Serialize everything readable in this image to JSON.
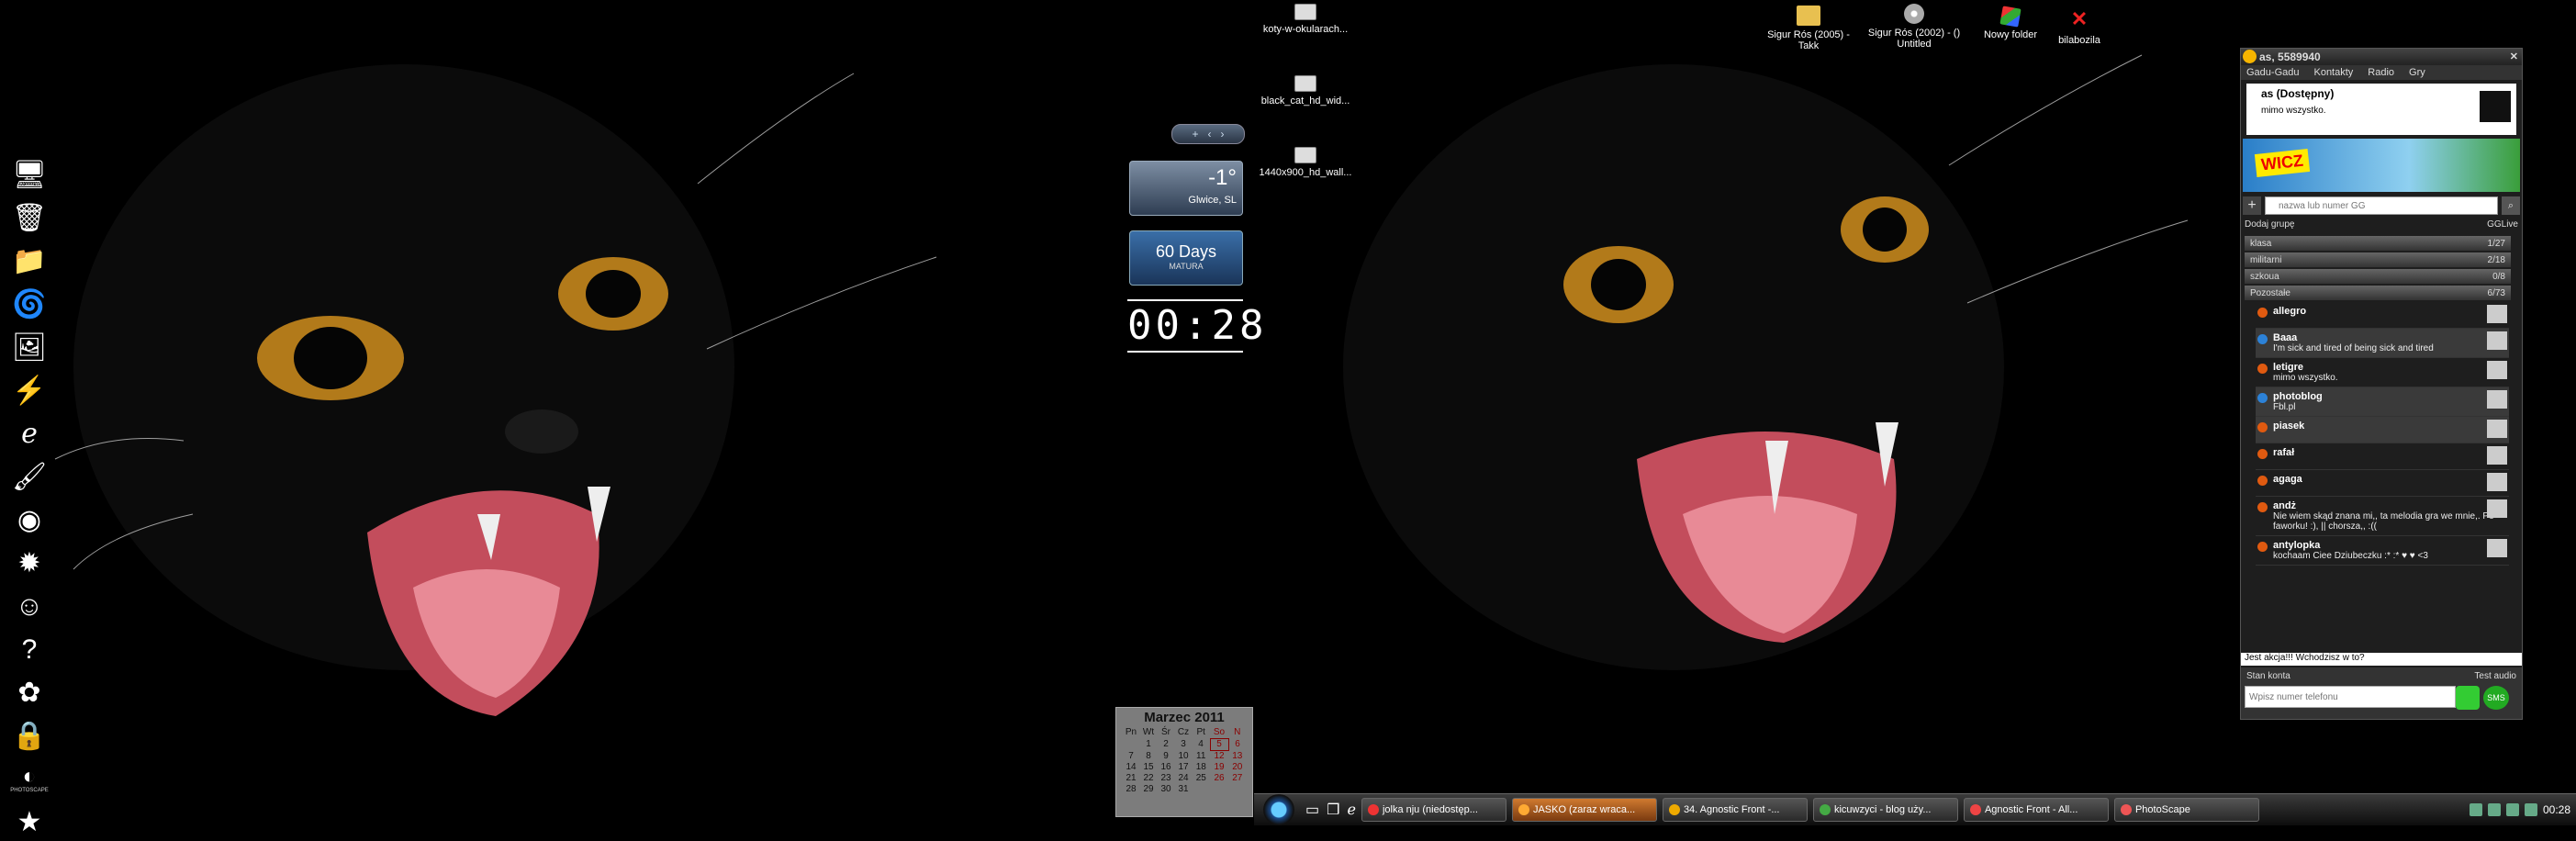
{
  "desktop": {
    "file_icons": [
      {
        "label": "koty-w-okularach..."
      },
      {
        "label": "black_cat_hd_wid..."
      },
      {
        "label": "1440x900_hd_wall..."
      }
    ],
    "top_icons": [
      {
        "label": "Sigur Rós (2005) - Takk",
        "icon": "folder-icon"
      },
      {
        "label": "Sigur Rós (2002) - () Untitled",
        "icon": "cd-icon"
      },
      {
        "label": "Nowy folder",
        "icon": "folder-icon"
      },
      {
        "label": "bilabozila",
        "icon": "x-icon"
      }
    ],
    "dock": [
      {
        "icon": "computer-icon",
        "glyph": "🖥"
      },
      {
        "icon": "recycle-bin-icon",
        "glyph": "🗑"
      },
      {
        "icon": "folder-icon",
        "glyph": "📁"
      },
      {
        "icon": "ccleaner-icon",
        "glyph": "🌀"
      },
      {
        "icon": "picture-icon",
        "glyph": "🖼"
      },
      {
        "icon": "winamp-icon",
        "glyph": "⚡"
      },
      {
        "icon": "internet-explorer-icon",
        "glyph": "ℯ"
      },
      {
        "icon": "paint-icon",
        "glyph": "🖌"
      },
      {
        "icon": "chrome-icon",
        "glyph": "◉"
      },
      {
        "icon": "gadu-gadu-icon",
        "glyph": "✹"
      },
      {
        "icon": "smiley-icon",
        "glyph": "☺"
      },
      {
        "icon": "help-icon",
        "glyph": "?"
      },
      {
        "icon": "picasa-icon",
        "glyph": "✿"
      },
      {
        "icon": "lock-icon",
        "glyph": "🔒"
      },
      {
        "icon": "photoscape-icon",
        "glyph": "◐",
        "label": "PHOTOSCAPE"
      },
      {
        "icon": "star-icon",
        "glyph": "★"
      }
    ]
  },
  "gadgets": {
    "toolbar": {
      "add": "+",
      "prev": "‹",
      "next": "›"
    },
    "weather": {
      "temp": "-1°",
      "city": "Glwice, SL"
    },
    "countdown": {
      "days": "60 Days",
      "label": "MATURA"
    },
    "clock": {
      "time": "00:28"
    },
    "calendar": {
      "title": "Marzec 2011",
      "weekdays": [
        "Pn",
        "Wt",
        "Śr",
        "Cz",
        "Pt",
        "So",
        "N"
      ],
      "weeks": [
        [
          "",
          "1",
          "2",
          "3",
          "4",
          "5",
          "6"
        ],
        [
          "7",
          "8",
          "9",
          "10",
          "11",
          "12",
          "13"
        ],
        [
          "14",
          "15",
          "16",
          "17",
          "18",
          "19",
          "20"
        ],
        [
          "21",
          "22",
          "23",
          "24",
          "25",
          "26",
          "27"
        ],
        [
          "28",
          "29",
          "30",
          "31",
          "",
          "",
          ""
        ]
      ],
      "today": "5"
    }
  },
  "gg": {
    "title": "as, 5589940",
    "menu": [
      "Gadu-Gadu",
      "Kontakty",
      "Radio",
      "Gry"
    ],
    "status_name": "as (Dostępny)",
    "status_desc": "mimo wszystko.",
    "ad_logo": "WICZ",
    "search_placeholder": "nazwa lub numer GG",
    "add_group": "Dodaj grupę",
    "gglive": "GGLive",
    "groups": [
      {
        "name": "klasa",
        "count": "1/27"
      },
      {
        "name": "militarni",
        "count": "2/18"
      },
      {
        "name": "szkoua",
        "count": "0/8"
      },
      {
        "name": "Pozostałe",
        "count": "6/73"
      }
    ],
    "contacts": [
      {
        "name": "allegro",
        "desc": "",
        "status": "available"
      },
      {
        "name": "Baaa",
        "desc": "I'm sick and tired of being sick and tired",
        "status": "busy"
      },
      {
        "name": "letigre",
        "desc": "mimo wszystko.",
        "status": "available"
      },
      {
        "name": "photoblog",
        "desc": "Fbl.pl",
        "status": "busy"
      },
      {
        "name": "piasek",
        "desc": "",
        "status": "available"
      },
      {
        "name": "rafał",
        "desc": "",
        "status": "available"
      },
      {
        "name": "agaga",
        "desc": "",
        "status": "available"
      },
      {
        "name": "andż",
        "desc": "Nie wiem skąd znana mi,, ta melodia gra we mnie,. Po faworku! :), || chorsza,, :((",
        "status": "available"
      },
      {
        "name": "antylopka",
        "desc": "kochaam Ciee Dziubeczku :* :* ♥ ♥ <3",
        "status": "available"
      }
    ],
    "notice": "Jest akcja!!! Wchodzisz w to?",
    "account_label": "Stan konta",
    "test_audio": "Test audio",
    "phone_placeholder": "Wpisz numer telefonu",
    "sms_label": "SMS"
  },
  "taskbar": {
    "tasks": [
      {
        "label": "jolka nju (niedostęp...",
        "color": "#e33",
        "active": false
      },
      {
        "label": "JASKO (zaraz wraca...",
        "color": "#fa3",
        "active": true
      },
      {
        "label": "34. Agnostic Front -...",
        "color": "#ea0",
        "active": false
      },
      {
        "label": "kicuwzyci - blog uży...",
        "color": "#4a4",
        "active": false
      },
      {
        "label": "Agnostic Front - All...",
        "color": "#e44",
        "active": false
      },
      {
        "label": "PhotoScape",
        "color": "#e55",
        "active": false
      }
    ],
    "time": "00:28"
  }
}
